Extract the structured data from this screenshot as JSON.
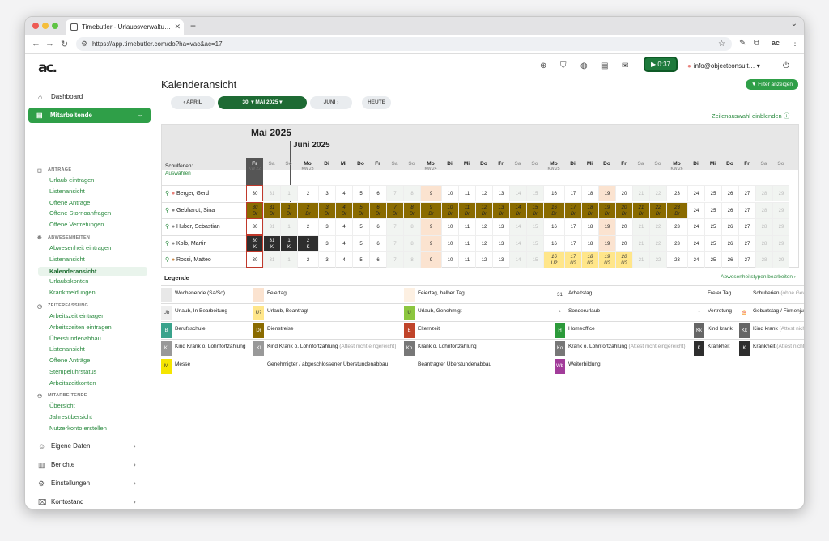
{
  "browser": {
    "tab_title": "Timebutler - Urlaubsverwaltu…",
    "url": "https://app.timebutler.com/do?ha=vac&ac=17"
  },
  "header": {
    "logo": "ac.",
    "timer": "▶ 0:37",
    "user": "info@objectconsult…"
  },
  "sidebar": {
    "dashboard": "Dashboard",
    "mitarbeitende": "Mitarbeitende",
    "antraege_head": "ANTRÄGE",
    "antraege": [
      "Urlaub eintragen",
      "Listenansicht",
      "Offene Anträge",
      "Offene Stornoanfragen",
      "Offene Vertretungen"
    ],
    "abwesenheiten_head": "ABWESENHEITEN",
    "abwesenheiten": [
      "Abwesenheit eintragen",
      "Listenansicht",
      "Kalenderansicht",
      "Urlaubskonten",
      "Krankmeldungen"
    ],
    "zeit_head": "ZEITERFASSUNG",
    "zeit": [
      "Arbeitszeit eintragen",
      "Arbeitszeiten eintragen",
      "Überstundenabbau",
      "Listenansicht",
      "Offene Anträge",
      "Stempeluhrstatus",
      "Arbeitszeitkonten"
    ],
    "mit_head": "MITARBEITENDE",
    "mit": [
      "Übersicht",
      "Jahresübersicht",
      "Nutzerkonto erstellen"
    ],
    "bottom": [
      "Eigene Daten",
      "Berichte",
      "Einstellungen",
      "Kontostand"
    ]
  },
  "main": {
    "title": "Kalenderansicht",
    "filter": "Filter anzeigen",
    "prev": "‹  APRIL",
    "current": "30.  ▾     MAI 2025  ▾",
    "next": "JUNI  ›",
    "today": "HEUTE",
    "zeilen": "Zeilenauswahl einblenden ⓘ",
    "month1": "Mai 2025",
    "month2": "Juni 2025",
    "schulferien": "Schulferien:",
    "auswaehlen": "Auswählen"
  },
  "days": [
    {
      "d": "Fr",
      "kw": "KW 22",
      "n": "30"
    },
    {
      "d": "Sa",
      "n": "31"
    },
    {
      "d": "So",
      "n": "1"
    },
    {
      "d": "Mo",
      "kw": "KW 23",
      "n": "2"
    },
    {
      "d": "Di",
      "n": "3"
    },
    {
      "d": "Mi",
      "n": "4"
    },
    {
      "d": "Do",
      "n": "5"
    },
    {
      "d": "Fr",
      "n": "6"
    },
    {
      "d": "Sa",
      "n": "7"
    },
    {
      "d": "So",
      "n": "8"
    },
    {
      "d": "Mo",
      "kw": "KW 24",
      "n": "9"
    },
    {
      "d": "Di",
      "n": "10"
    },
    {
      "d": "Mi",
      "n": "11"
    },
    {
      "d": "Do",
      "n": "12"
    },
    {
      "d": "Fr",
      "n": "13"
    },
    {
      "d": "Sa",
      "n": "14"
    },
    {
      "d": "So",
      "n": "15"
    },
    {
      "d": "Mo",
      "kw": "KW 25",
      "n": "16"
    },
    {
      "d": "Di",
      "n": "17"
    },
    {
      "d": "Mi",
      "n": "18"
    },
    {
      "d": "Do",
      "n": "19"
    },
    {
      "d": "Fr",
      "n": "20"
    },
    {
      "d": "Sa",
      "n": "21"
    },
    {
      "d": "So",
      "n": "22"
    },
    {
      "d": "Mo",
      "kw": "KW 26",
      "n": "23"
    },
    {
      "d": "Di",
      "n": "24"
    },
    {
      "d": "Mi",
      "n": "25"
    },
    {
      "d": "Do",
      "n": "26"
    },
    {
      "d": "Fr",
      "n": "27"
    },
    {
      "d": "Sa",
      "n": "28"
    },
    {
      "d": "So",
      "n": "29"
    }
  ],
  "employees": [
    {
      "name": "Berger, Gerd",
      "color": "#e8827c",
      "cells": {}
    },
    {
      "name": "Gebhardt, Sina",
      "color": "#888",
      "cells": {
        "dr": [
          0,
          24
        ]
      }
    },
    {
      "name": "Huber, Sebastian",
      "color": "#888",
      "cells": {}
    },
    {
      "name": "Kolb, Martin",
      "color": "#888",
      "cells": {
        "k": [
          0,
          3
        ]
      }
    },
    {
      "name": "Rossi, Matteo",
      "color": "#c98a4a",
      "cells": {
        "u": [
          17,
          21
        ]
      }
    }
  ],
  "legend": {
    "title": "Legende",
    "edit": "Abwesenheitstypen bearbeiten ›",
    "items": [
      {
        "sw": "",
        "bg": "#e8e8e8",
        "t": "Wochenende (Sa/So)"
      },
      {
        "sw": "",
        "bg": "#fbe3d0",
        "t": "Feiertag"
      },
      {
        "sw": "",
        "bg": "#fdf0e2",
        "t": "Feiertag, halber Tag"
      },
      {
        "sw": "31",
        "bg": "#fff",
        "t": "Arbeitstag"
      },
      {
        "sw": "",
        "bg": "#fff",
        "t": "Freier Tag"
      },
      {
        "sw": "",
        "bg": "#fff",
        "t": "Schulferien",
        "g": "(ohne Gewähr)"
      },
      {
        "sw": "Ub",
        "bg": "#eee",
        "t": "Urlaub, In Bearbeitung"
      },
      {
        "sw": "U?",
        "bg": "#ffe68a",
        "t": "Urlaub, Beantragt"
      },
      {
        "sw": "U",
        "bg": "#8cc63f",
        "t": "Urlaub, Genehmigt"
      },
      {
        "sw": "*",
        "bg": "#fff",
        "t": "Sonderurlaub"
      },
      {
        "sw": "*",
        "bg": "#fff",
        "t": "Vertretung"
      },
      {
        "sw": "🎂",
        "bg": "#fff",
        "t": "Geburtstag / Firmenjubiläum"
      },
      {
        "sw": "B",
        "bg": "#3aa38c",
        "t": "Berufsschule"
      },
      {
        "sw": "Dr",
        "bg": "#8a6b00",
        "t": "Dienstreise"
      },
      {
        "sw": "E",
        "bg": "#c0442a",
        "t": "Elternzeit"
      },
      {
        "sw": "H",
        "bg": "#2c9a3a",
        "t": "Homeoffice"
      },
      {
        "sw": "Kk",
        "bg": "#666",
        "t": "Kind krank"
      },
      {
        "sw": "Kk",
        "bg": "#666",
        "t": "Kind krank",
        "g": "(Attest nicht eingereicht)"
      },
      {
        "sw": "Kl",
        "bg": "#999",
        "t": "Kind Krank o. Lohnfortzahlung"
      },
      {
        "sw": "Kl",
        "bg": "#999",
        "t": "Kind Krank o. Lohnfortzahlung",
        "g": "(Attest nicht eingereicht)"
      },
      {
        "sw": "Ko",
        "bg": "#777",
        "t": "Krank o. Lohnfortzahlung"
      },
      {
        "sw": "Ko",
        "bg": "#777",
        "t": "Krank o. Lohnfortzahlung",
        "g": "(Attest nicht eingereicht)"
      },
      {
        "sw": "K",
        "bg": "#2e2e2e",
        "t": "Krankheit"
      },
      {
        "sw": "K",
        "bg": "#2e2e2e",
        "t": "Krankheit",
        "g": "(Attest nicht eingereicht)"
      },
      {
        "sw": "M",
        "bg": "#f5e500",
        "t": "Messe"
      },
      {
        "sw": "",
        "bg": "#fff",
        "t": "Genehmigter / abgeschlossener Überstundenabbau"
      },
      {
        "sw": "",
        "bg": "#fff",
        "t": "Beantragter Überstundenabbau"
      },
      {
        "sw": "Wb",
        "bg": "#a23c9a",
        "t": "Weiterbildung"
      }
    ]
  }
}
